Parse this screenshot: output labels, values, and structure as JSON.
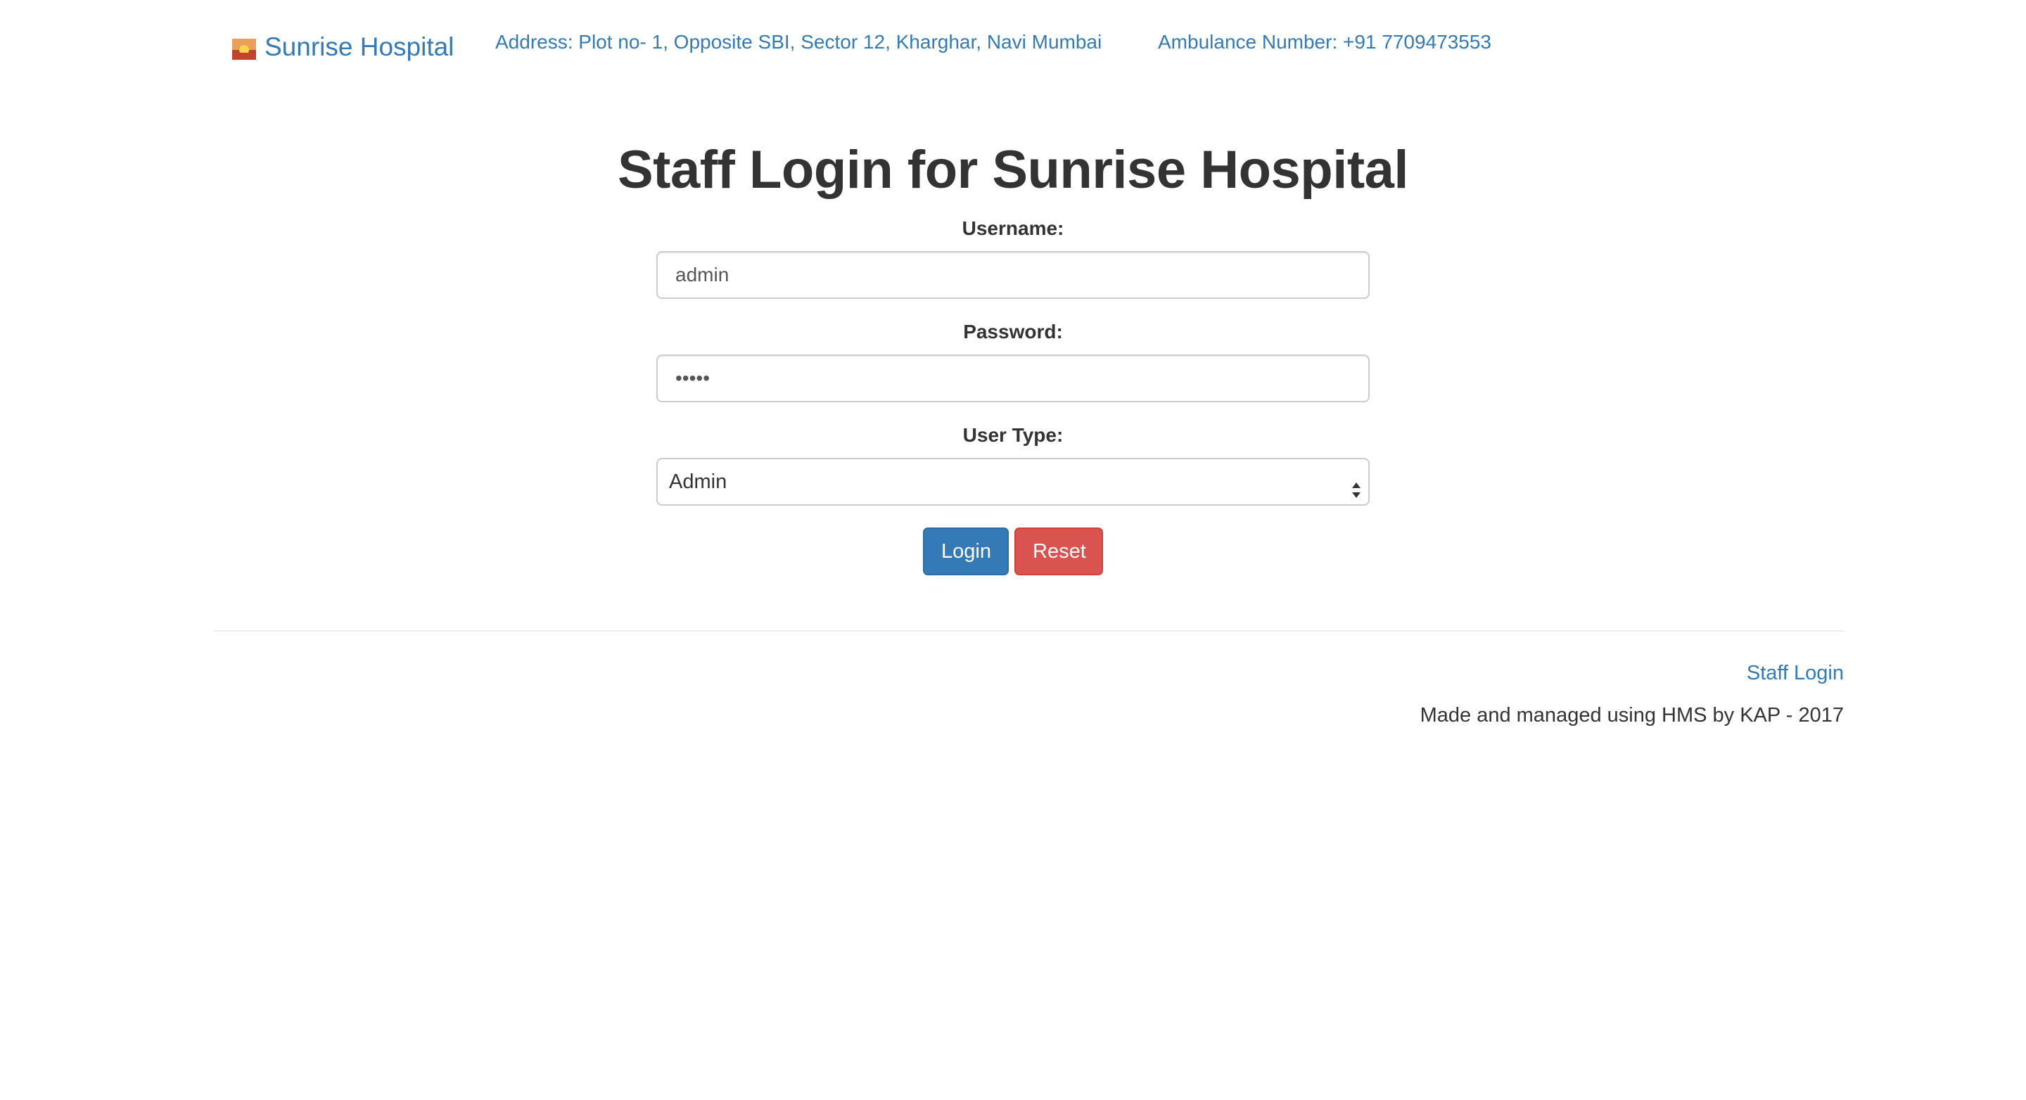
{
  "navbar": {
    "brand_name": "Sunrise Hospital",
    "logo_icon": "sunrise-logo-icon",
    "address": "Address: Plot no- 1, Opposite SBI, Sector 12, Kharghar, Navi Mumbai",
    "ambulance": "Ambulance Number: +91 7709473553"
  },
  "login_form": {
    "title": "Staff Login for Sunrise Hospital",
    "username_label": "Username:",
    "username_value": "admin",
    "password_label": "Password:",
    "password_value": "•••••",
    "user_type_label": "User Type:",
    "user_type_selected": "Admin",
    "login_button": "Login",
    "reset_button": "Reset"
  },
  "footer": {
    "staff_login_link": "Staff Login",
    "credits": "Made and managed using HMS by KAP - 2017"
  },
  "colors": {
    "link": "#337ab7",
    "primary_button": "#337ab7",
    "danger_button": "#d9534f",
    "text": "#333333"
  }
}
